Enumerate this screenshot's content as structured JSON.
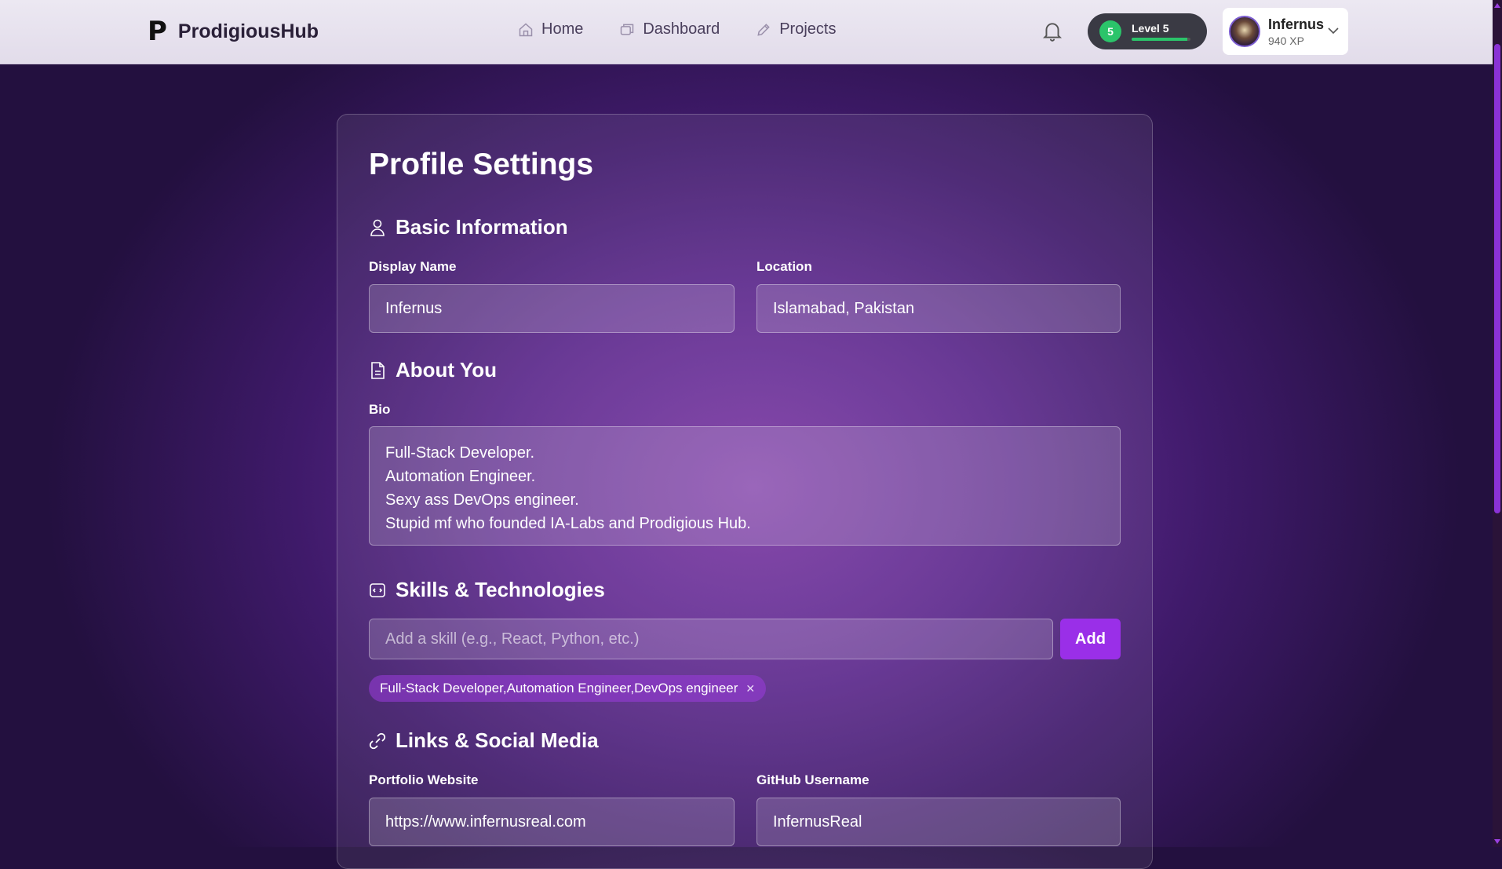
{
  "header": {
    "logo_mark": "P",
    "brand": "ProdigiousHub",
    "nav": [
      {
        "label": "Home",
        "icon": "home-icon"
      },
      {
        "label": "Dashboard",
        "icon": "dashboard-icon"
      },
      {
        "label": "Projects",
        "icon": "pencil-icon"
      }
    ],
    "notifications_icon": "bell-icon",
    "level": {
      "number": "5",
      "label": "Level 5",
      "progress": 0.95,
      "color": "#2bc46a"
    },
    "user": {
      "name": "Infernus",
      "xp": "940 XP"
    }
  },
  "page": {
    "title": "Profile Settings",
    "sections": {
      "basic": {
        "title": "Basic Information",
        "display_name_label": "Display Name",
        "display_name_value": "Infernus",
        "location_label": "Location",
        "location_value": "Islamabad, Pakistan"
      },
      "about": {
        "title": "About You",
        "bio_label": "Bio",
        "bio_lines": [
          "Full-Stack Developer.",
          "Automation Engineer.",
          "Sexy ass DevOps engineer.",
          "Stupid mf who founded IA-Labs and Prodigious Hub."
        ]
      },
      "skills": {
        "title": "Skills & Technologies",
        "input_placeholder": "Add a skill (e.g., React, Python, etc.)",
        "add_label": "Add",
        "chips": [
          "Full-Stack Developer,Automation Engineer,DevOps engineer"
        ],
        "remove_symbol": "✕"
      },
      "links": {
        "title": "Links & Social Media",
        "portfolio_label": "Portfolio Website",
        "portfolio_value": "https://www.infernusreal.com",
        "github_label": "GitHub Username",
        "github_value": "InfernusReal"
      }
    }
  },
  "colors": {
    "accent": "#9a2fe8",
    "level_green": "#2bc46a"
  }
}
